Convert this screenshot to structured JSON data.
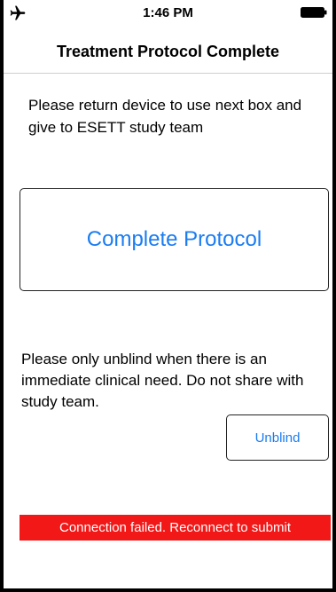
{
  "status_bar": {
    "time": "1:46 PM",
    "airplane_icon": "airplane-icon",
    "battery_icon": "battery-icon"
  },
  "nav": {
    "title": "Treatment Protocol Complete"
  },
  "instruction": {
    "text": "Please return device to use next box and give to ESETT study team"
  },
  "complete_button": {
    "label": "Complete Protocol"
  },
  "warning": {
    "text": "Please only unblind when there is an immediate clinical need.  Do not share with study team."
  },
  "unblind_button": {
    "label": "Unblind"
  },
  "error_banner": {
    "text": "Connection failed.  Reconnect to submit"
  },
  "colors": {
    "accent": "#1a7cf2",
    "error": "#f21818",
    "text": "#000000"
  }
}
